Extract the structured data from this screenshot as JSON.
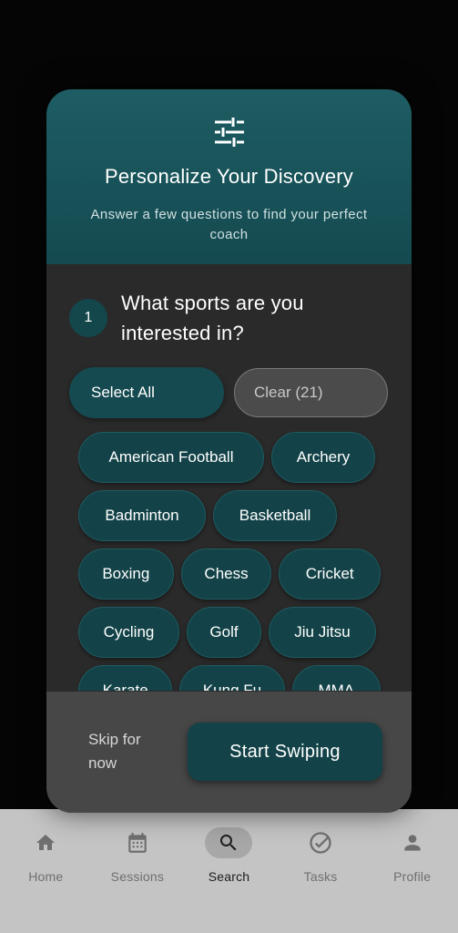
{
  "modal": {
    "title": "Personalize Your Discovery",
    "subtitle": "Answer a few questions to find your perfect coach",
    "header_icon": "tune-sliders-icon",
    "question": {
      "number": "1",
      "text": "What sports are you interested in?"
    },
    "select_all_label": "Select All",
    "clear_label": "Clear (21)",
    "sports": [
      [
        "American Football",
        "Archery"
      ],
      [
        "Badminton",
        "Basketball"
      ],
      [
        "Boxing",
        "Chess",
        "Cricket"
      ],
      [
        "Cycling",
        "Golf",
        "Jiu Jitsu"
      ],
      [
        "Karate",
        "Kung Fu",
        "MMA"
      ]
    ],
    "skip_label": "Skip for now",
    "start_label": "Start Swiping"
  },
  "nav": {
    "items": [
      {
        "label": "Home",
        "icon": "home-icon"
      },
      {
        "label": "Sessions",
        "icon": "calendar-icon"
      },
      {
        "label": "Search",
        "icon": "search-icon",
        "active": true
      },
      {
        "label": "Tasks",
        "icon": "task-check-icon"
      },
      {
        "label": "Profile",
        "icon": "person-icon"
      }
    ]
  },
  "colors": {
    "accent": "#134348",
    "header": "#1d5d63",
    "card": "#2a2a2a",
    "footer": "#474747"
  }
}
